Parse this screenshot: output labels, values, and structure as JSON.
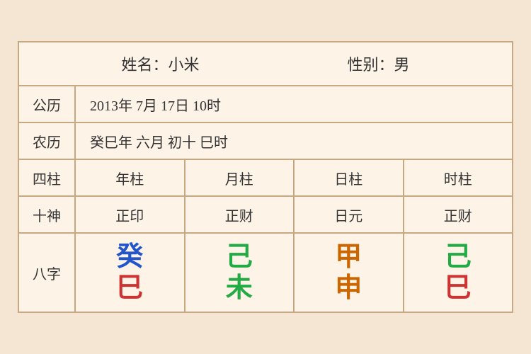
{
  "header": {
    "name_label": "姓名：小米",
    "gender_label": "性别：男"
  },
  "rows": {
    "calendar_label": "公历",
    "calendar_value": "2013年 7月 17日 10时",
    "lunar_label": "农历",
    "lunar_value": "癸巳年 六月 初十 巳时"
  },
  "grid": {
    "sizhu_label": "四柱",
    "shishen_label": "十神",
    "bazhi_label": "八字",
    "columns": [
      "年柱",
      "月柱",
      "日柱",
      "时柱"
    ],
    "shishen": [
      "正印",
      "正财",
      "日元",
      "正财"
    ],
    "bazhi_top": [
      {
        "char": "癸",
        "color": "blue"
      },
      {
        "char": "己",
        "color": "green"
      },
      {
        "char": "甲",
        "color": "orange"
      },
      {
        "char": "己",
        "color": "green"
      }
    ],
    "bazhi_bottom": [
      {
        "char": "巳",
        "color": "red"
      },
      {
        "char": "未",
        "color": "green"
      },
      {
        "char": "申",
        "color": "orange"
      },
      {
        "char": "巳",
        "color": "red"
      }
    ]
  }
}
